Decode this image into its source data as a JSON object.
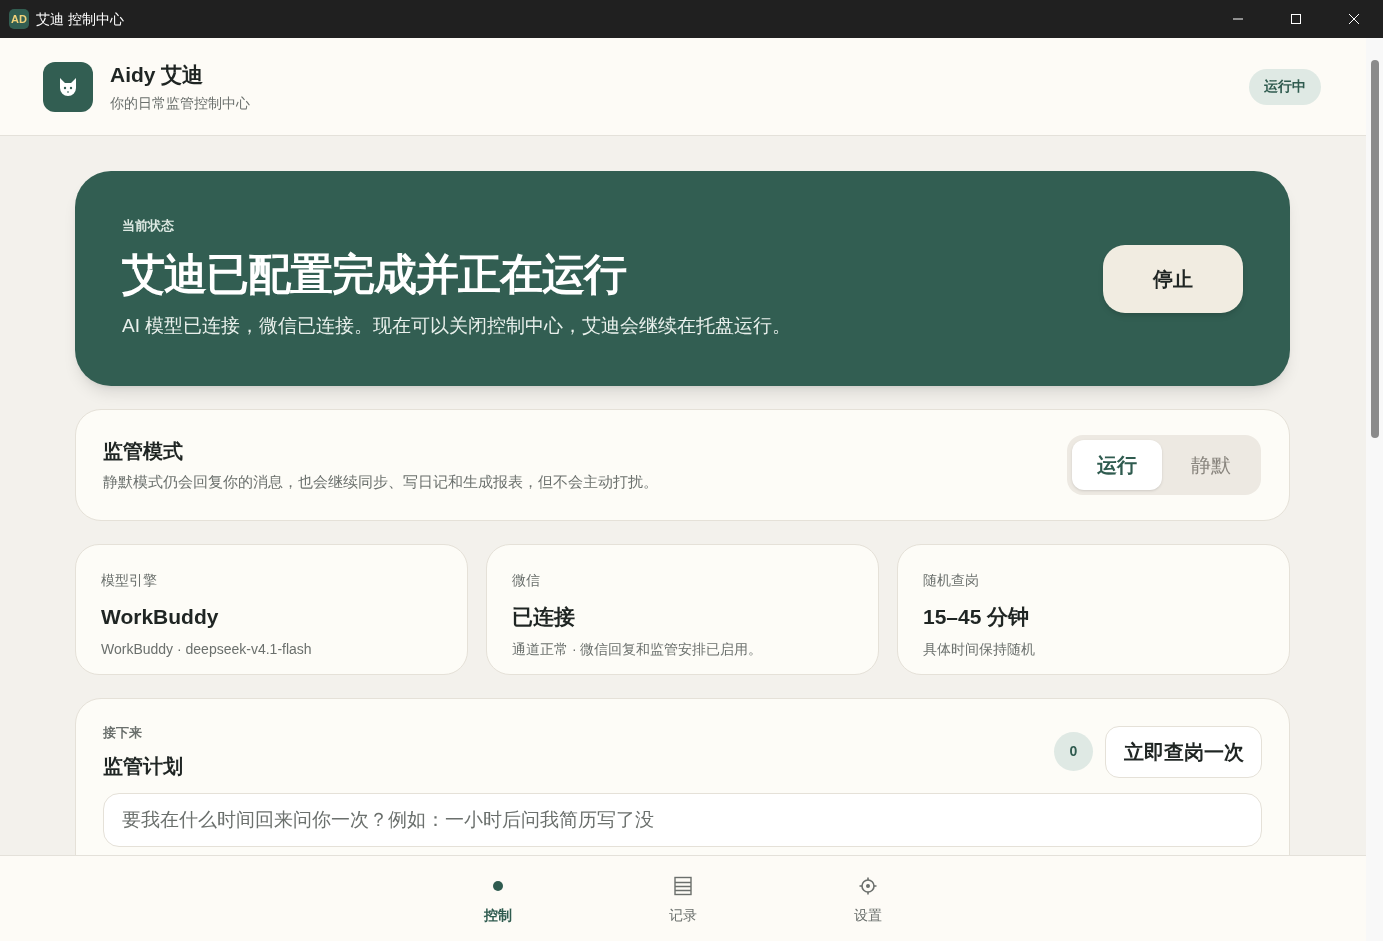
{
  "window": {
    "app_badge": "AD",
    "title": "艾迪 控制中心"
  },
  "header": {
    "name": "Aidy 艾迪",
    "subtitle": "你的日常监管控制中心",
    "status": "运行中"
  },
  "hero": {
    "eyebrow": "当前状态",
    "title": "艾迪已配置完成并正在运行",
    "description": "AI 模型已连接，微信已连接。现在可以关闭控制中心，艾迪会继续在托盘运行。",
    "button": "停止"
  },
  "mode": {
    "title": "监管模式",
    "description": "静默模式仍会回复你的消息，也会继续同步、写日记和生成报表，但不会主动打扰。",
    "options": [
      {
        "label": "运行",
        "selected": true
      },
      {
        "label": "静默",
        "selected": false
      }
    ]
  },
  "stats": [
    {
      "label": "模型引擎",
      "value": "WorkBuddy",
      "detail": "WorkBuddy · deepseek-v4.1-flash"
    },
    {
      "label": "微信",
      "value": "已连接",
      "detail": "通道正常 · 微信回复和监管安排已启用。"
    },
    {
      "label": "随机查岗",
      "value": "15–45 分钟",
      "detail": "具体时间保持随机"
    }
  ],
  "plan": {
    "eyebrow": "接下来",
    "title": "监管计划",
    "count": "0",
    "button": "立即查岗一次",
    "placeholder": "要我在什么时间回来问你一次？例如：一小时后问我简历写了没"
  },
  "nav": [
    {
      "label": "控制",
      "kind": "dot",
      "selected": true
    },
    {
      "label": "记录",
      "kind": "list",
      "selected": false
    },
    {
      "label": "设置",
      "kind": "gear",
      "selected": false
    }
  ]
}
